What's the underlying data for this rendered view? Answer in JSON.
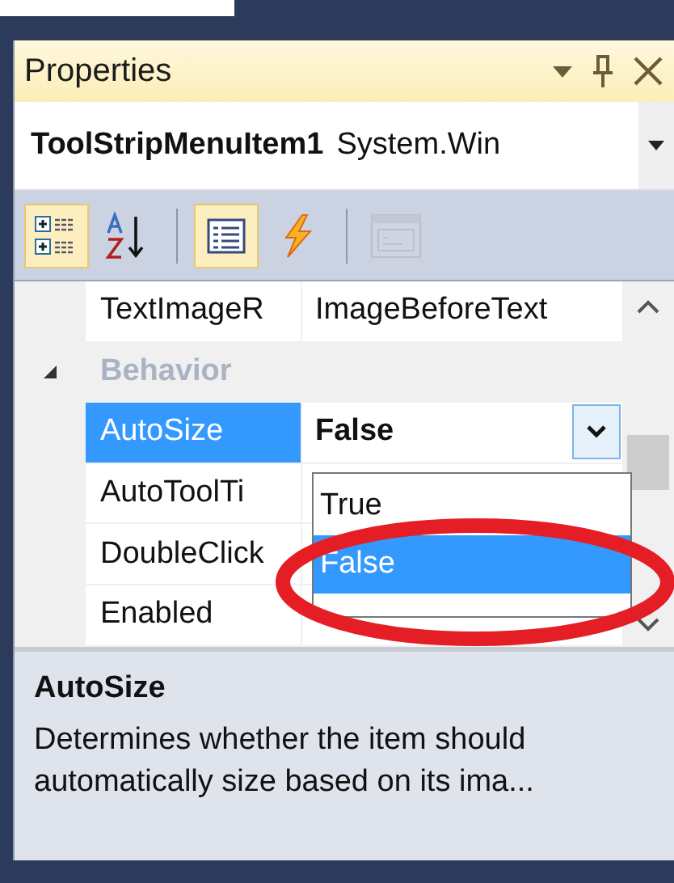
{
  "window": {
    "title": "Properties"
  },
  "object_selector": {
    "name": "ToolStripMenuItem1",
    "type": "System.Win"
  },
  "toolbar": [
    {
      "kind": "categorized",
      "selected": true,
      "disabled": false
    },
    {
      "kind": "alphabetical",
      "selected": false,
      "disabled": false
    },
    {
      "kind": "separator"
    },
    {
      "kind": "properties",
      "selected": true,
      "disabled": false
    },
    {
      "kind": "events",
      "selected": false,
      "disabled": false
    },
    {
      "kind": "separator"
    },
    {
      "kind": "property_pages",
      "selected": false,
      "disabled": true
    }
  ],
  "grid": [
    {
      "kind": "property",
      "name": "TextImageR",
      "value": "ImageBeforeText",
      "selected": false,
      "modified": false
    },
    {
      "kind": "category",
      "name": "Behavior",
      "expanded": true
    },
    {
      "kind": "property",
      "name": "AutoSize",
      "value": "False",
      "selected": true,
      "modified": true,
      "editing": true
    },
    {
      "kind": "property",
      "name": "AutoToolTi",
      "selected": false
    },
    {
      "kind": "property",
      "name": "DoubleClick",
      "selected": false
    },
    {
      "kind": "property",
      "name": "Enabled",
      "selected": false
    }
  ],
  "dropdown": {
    "options": [
      {
        "label": "True",
        "selected": false
      },
      {
        "label": "False",
        "selected": true
      }
    ]
  },
  "description": {
    "title": "AutoSize",
    "text": "Determines whether the item should automatically size based on its ima..."
  }
}
